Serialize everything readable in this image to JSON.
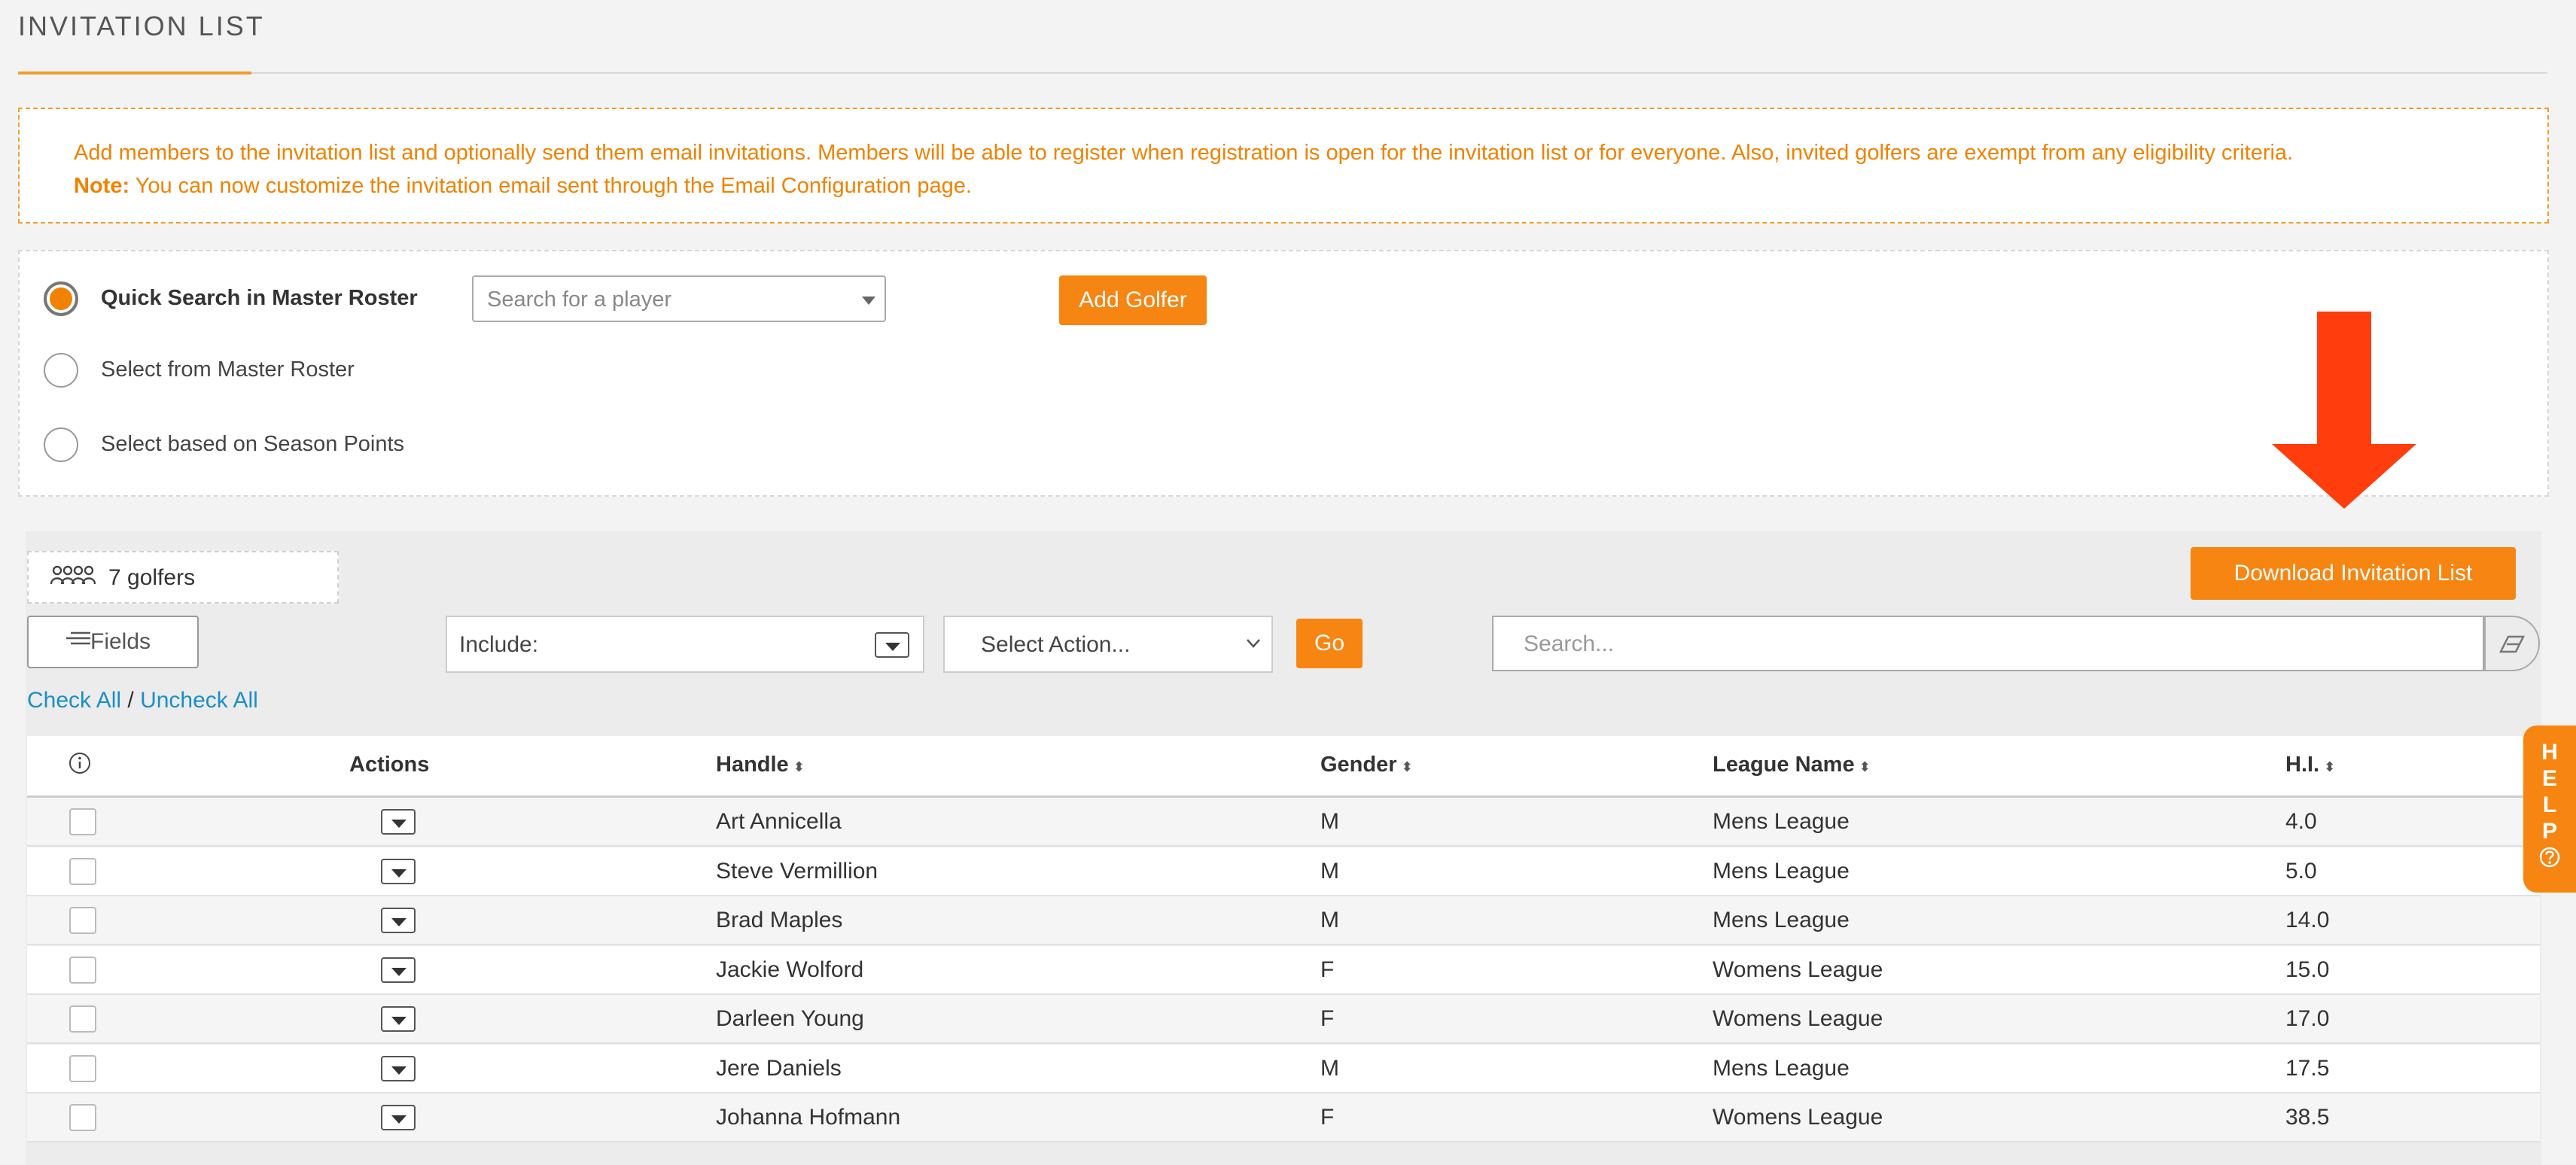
{
  "page": {
    "title": "INVITATION LIST"
  },
  "notice": {
    "text": "Add members to the invitation list and optionally send them email invitations. Members will be able to register when registration is open for the invitation list or for everyone. Also, invited golfers are exempt from any eligibility criteria.",
    "note_label": "Note:",
    "note_text": " You can now customize the invitation email sent through the Email Configuration page."
  },
  "options": {
    "quick_search_label": "Quick Search in Master Roster",
    "master_roster_label": "Select from Master Roster",
    "season_points_label": "Select based on Season Points",
    "selected": "quick_search",
    "player_search_placeholder": "Search for a player",
    "add_golfer_label": "Add Golfer"
  },
  "toolbar": {
    "golfer_count": "7 golfers",
    "download_label": "Download Invitation List",
    "fields_label": "Fields",
    "include_label": "Include:",
    "action_label": "Select Action...",
    "go_label": "Go",
    "search_placeholder": "Search...",
    "check_all": "Check All",
    "separator": " / ",
    "uncheck_all": "Uncheck All"
  },
  "table": {
    "columns": {
      "actions": "Actions",
      "handle": "Handle",
      "gender": "Gender",
      "league": "League Name",
      "hi": "H.I."
    },
    "rows": [
      {
        "handle": "Art Annicella",
        "gender": "M",
        "league": "Mens League",
        "hi": "4.0"
      },
      {
        "handle": "Steve Vermillion",
        "gender": "M",
        "league": "Mens League",
        "hi": "5.0"
      },
      {
        "handle": "Brad Maples",
        "gender": "M",
        "league": "Mens League",
        "hi": "14.0"
      },
      {
        "handle": "Jackie Wolford",
        "gender": "F",
        "league": "Womens League",
        "hi": "15.0"
      },
      {
        "handle": "Darleen Young",
        "gender": "F",
        "league": "Womens League",
        "hi": "17.0"
      },
      {
        "handle": "Jere Daniels",
        "gender": "M",
        "league": "Mens League",
        "hi": "17.5"
      },
      {
        "handle": "Johanna Hofmann",
        "gender": "F",
        "league": "Womens League",
        "hi": "38.5"
      }
    ]
  },
  "help": {
    "letters": [
      "H",
      "E",
      "L",
      "P"
    ]
  },
  "colors": {
    "accent": "#f68512",
    "link": "#1a8ec7",
    "annotation_arrow": "#ff3d0d"
  }
}
